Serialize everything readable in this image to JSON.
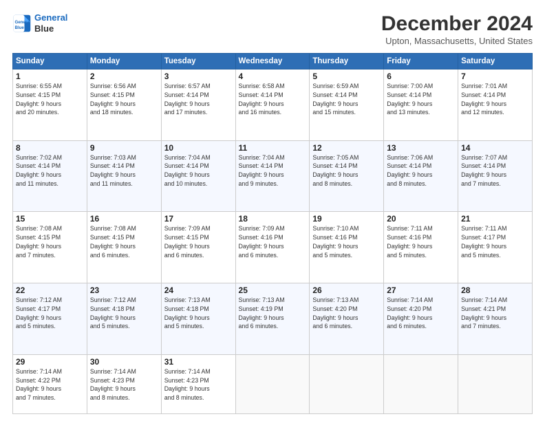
{
  "header": {
    "logo_line1": "General",
    "logo_line2": "Blue",
    "month": "December 2024",
    "location": "Upton, Massachusetts, United States"
  },
  "weekdays": [
    "Sunday",
    "Monday",
    "Tuesday",
    "Wednesday",
    "Thursday",
    "Friday",
    "Saturday"
  ],
  "weeks": [
    [
      {
        "day": "1",
        "info": "Sunrise: 6:55 AM\nSunset: 4:15 PM\nDaylight: 9 hours\nand 20 minutes."
      },
      {
        "day": "2",
        "info": "Sunrise: 6:56 AM\nSunset: 4:15 PM\nDaylight: 9 hours\nand 18 minutes."
      },
      {
        "day": "3",
        "info": "Sunrise: 6:57 AM\nSunset: 4:14 PM\nDaylight: 9 hours\nand 17 minutes."
      },
      {
        "day": "4",
        "info": "Sunrise: 6:58 AM\nSunset: 4:14 PM\nDaylight: 9 hours\nand 16 minutes."
      },
      {
        "day": "5",
        "info": "Sunrise: 6:59 AM\nSunset: 4:14 PM\nDaylight: 9 hours\nand 15 minutes."
      },
      {
        "day": "6",
        "info": "Sunrise: 7:00 AM\nSunset: 4:14 PM\nDaylight: 9 hours\nand 13 minutes."
      },
      {
        "day": "7",
        "info": "Sunrise: 7:01 AM\nSunset: 4:14 PM\nDaylight: 9 hours\nand 12 minutes."
      }
    ],
    [
      {
        "day": "8",
        "info": "Sunrise: 7:02 AM\nSunset: 4:14 PM\nDaylight: 9 hours\nand 11 minutes."
      },
      {
        "day": "9",
        "info": "Sunrise: 7:03 AM\nSunset: 4:14 PM\nDaylight: 9 hours\nand 11 minutes."
      },
      {
        "day": "10",
        "info": "Sunrise: 7:04 AM\nSunset: 4:14 PM\nDaylight: 9 hours\nand 10 minutes."
      },
      {
        "day": "11",
        "info": "Sunrise: 7:04 AM\nSunset: 4:14 PM\nDaylight: 9 hours\nand 9 minutes."
      },
      {
        "day": "12",
        "info": "Sunrise: 7:05 AM\nSunset: 4:14 PM\nDaylight: 9 hours\nand 8 minutes."
      },
      {
        "day": "13",
        "info": "Sunrise: 7:06 AM\nSunset: 4:14 PM\nDaylight: 9 hours\nand 8 minutes."
      },
      {
        "day": "14",
        "info": "Sunrise: 7:07 AM\nSunset: 4:14 PM\nDaylight: 9 hours\nand 7 minutes."
      }
    ],
    [
      {
        "day": "15",
        "info": "Sunrise: 7:08 AM\nSunset: 4:15 PM\nDaylight: 9 hours\nand 7 minutes."
      },
      {
        "day": "16",
        "info": "Sunrise: 7:08 AM\nSunset: 4:15 PM\nDaylight: 9 hours\nand 6 minutes."
      },
      {
        "day": "17",
        "info": "Sunrise: 7:09 AM\nSunset: 4:15 PM\nDaylight: 9 hours\nand 6 minutes."
      },
      {
        "day": "18",
        "info": "Sunrise: 7:09 AM\nSunset: 4:16 PM\nDaylight: 9 hours\nand 6 minutes."
      },
      {
        "day": "19",
        "info": "Sunrise: 7:10 AM\nSunset: 4:16 PM\nDaylight: 9 hours\nand 5 minutes."
      },
      {
        "day": "20",
        "info": "Sunrise: 7:11 AM\nSunset: 4:16 PM\nDaylight: 9 hours\nand 5 minutes."
      },
      {
        "day": "21",
        "info": "Sunrise: 7:11 AM\nSunset: 4:17 PM\nDaylight: 9 hours\nand 5 minutes."
      }
    ],
    [
      {
        "day": "22",
        "info": "Sunrise: 7:12 AM\nSunset: 4:17 PM\nDaylight: 9 hours\nand 5 minutes."
      },
      {
        "day": "23",
        "info": "Sunrise: 7:12 AM\nSunset: 4:18 PM\nDaylight: 9 hours\nand 5 minutes."
      },
      {
        "day": "24",
        "info": "Sunrise: 7:13 AM\nSunset: 4:18 PM\nDaylight: 9 hours\nand 5 minutes."
      },
      {
        "day": "25",
        "info": "Sunrise: 7:13 AM\nSunset: 4:19 PM\nDaylight: 9 hours\nand 6 minutes."
      },
      {
        "day": "26",
        "info": "Sunrise: 7:13 AM\nSunset: 4:20 PM\nDaylight: 9 hours\nand 6 minutes."
      },
      {
        "day": "27",
        "info": "Sunrise: 7:14 AM\nSunset: 4:20 PM\nDaylight: 9 hours\nand 6 minutes."
      },
      {
        "day": "28",
        "info": "Sunrise: 7:14 AM\nSunset: 4:21 PM\nDaylight: 9 hours\nand 7 minutes."
      }
    ],
    [
      {
        "day": "29",
        "info": "Sunrise: 7:14 AM\nSunset: 4:22 PM\nDaylight: 9 hours\nand 7 minutes."
      },
      {
        "day": "30",
        "info": "Sunrise: 7:14 AM\nSunset: 4:23 PM\nDaylight: 9 hours\nand 8 minutes."
      },
      {
        "day": "31",
        "info": "Sunrise: 7:14 AM\nSunset: 4:23 PM\nDaylight: 9 hours\nand 8 minutes."
      },
      null,
      null,
      null,
      null
    ]
  ]
}
